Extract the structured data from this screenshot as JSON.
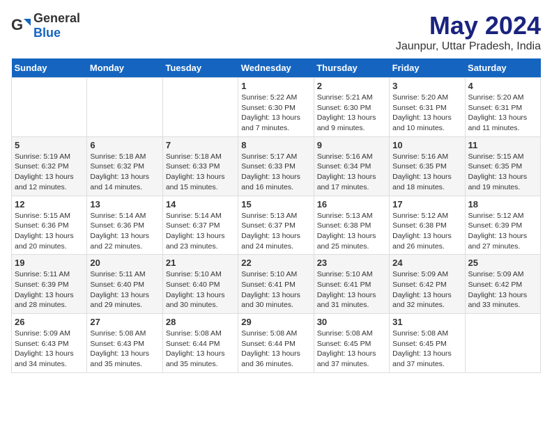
{
  "logo": {
    "general": "General",
    "blue": "Blue"
  },
  "header": {
    "month_year": "May 2024",
    "location": "Jaunpur, Uttar Pradesh, India"
  },
  "days_of_week": [
    "Sunday",
    "Monday",
    "Tuesday",
    "Wednesday",
    "Thursday",
    "Friday",
    "Saturday"
  ],
  "weeks": [
    [
      {
        "day": "",
        "info": ""
      },
      {
        "day": "",
        "info": ""
      },
      {
        "day": "",
        "info": ""
      },
      {
        "day": "1",
        "info": "Sunrise: 5:22 AM\nSunset: 6:30 PM\nDaylight: 13 hours\nand 7 minutes."
      },
      {
        "day": "2",
        "info": "Sunrise: 5:21 AM\nSunset: 6:30 PM\nDaylight: 13 hours\nand 9 minutes."
      },
      {
        "day": "3",
        "info": "Sunrise: 5:20 AM\nSunset: 6:31 PM\nDaylight: 13 hours\nand 10 minutes."
      },
      {
        "day": "4",
        "info": "Sunrise: 5:20 AM\nSunset: 6:31 PM\nDaylight: 13 hours\nand 11 minutes."
      }
    ],
    [
      {
        "day": "5",
        "info": "Sunrise: 5:19 AM\nSunset: 6:32 PM\nDaylight: 13 hours\nand 12 minutes."
      },
      {
        "day": "6",
        "info": "Sunrise: 5:18 AM\nSunset: 6:32 PM\nDaylight: 13 hours\nand 14 minutes."
      },
      {
        "day": "7",
        "info": "Sunrise: 5:18 AM\nSunset: 6:33 PM\nDaylight: 13 hours\nand 15 minutes."
      },
      {
        "day": "8",
        "info": "Sunrise: 5:17 AM\nSunset: 6:33 PM\nDaylight: 13 hours\nand 16 minutes."
      },
      {
        "day": "9",
        "info": "Sunrise: 5:16 AM\nSunset: 6:34 PM\nDaylight: 13 hours\nand 17 minutes."
      },
      {
        "day": "10",
        "info": "Sunrise: 5:16 AM\nSunset: 6:35 PM\nDaylight: 13 hours\nand 18 minutes."
      },
      {
        "day": "11",
        "info": "Sunrise: 5:15 AM\nSunset: 6:35 PM\nDaylight: 13 hours\nand 19 minutes."
      }
    ],
    [
      {
        "day": "12",
        "info": "Sunrise: 5:15 AM\nSunset: 6:36 PM\nDaylight: 13 hours\nand 20 minutes."
      },
      {
        "day": "13",
        "info": "Sunrise: 5:14 AM\nSunset: 6:36 PM\nDaylight: 13 hours\nand 22 minutes."
      },
      {
        "day": "14",
        "info": "Sunrise: 5:14 AM\nSunset: 6:37 PM\nDaylight: 13 hours\nand 23 minutes."
      },
      {
        "day": "15",
        "info": "Sunrise: 5:13 AM\nSunset: 6:37 PM\nDaylight: 13 hours\nand 24 minutes."
      },
      {
        "day": "16",
        "info": "Sunrise: 5:13 AM\nSunset: 6:38 PM\nDaylight: 13 hours\nand 25 minutes."
      },
      {
        "day": "17",
        "info": "Sunrise: 5:12 AM\nSunset: 6:38 PM\nDaylight: 13 hours\nand 26 minutes."
      },
      {
        "day": "18",
        "info": "Sunrise: 5:12 AM\nSunset: 6:39 PM\nDaylight: 13 hours\nand 27 minutes."
      }
    ],
    [
      {
        "day": "19",
        "info": "Sunrise: 5:11 AM\nSunset: 6:39 PM\nDaylight: 13 hours\nand 28 minutes."
      },
      {
        "day": "20",
        "info": "Sunrise: 5:11 AM\nSunset: 6:40 PM\nDaylight: 13 hours\nand 29 minutes."
      },
      {
        "day": "21",
        "info": "Sunrise: 5:10 AM\nSunset: 6:40 PM\nDaylight: 13 hours\nand 30 minutes."
      },
      {
        "day": "22",
        "info": "Sunrise: 5:10 AM\nSunset: 6:41 PM\nDaylight: 13 hours\nand 30 minutes."
      },
      {
        "day": "23",
        "info": "Sunrise: 5:10 AM\nSunset: 6:41 PM\nDaylight: 13 hours\nand 31 minutes."
      },
      {
        "day": "24",
        "info": "Sunrise: 5:09 AM\nSunset: 6:42 PM\nDaylight: 13 hours\nand 32 minutes."
      },
      {
        "day": "25",
        "info": "Sunrise: 5:09 AM\nSunset: 6:42 PM\nDaylight: 13 hours\nand 33 minutes."
      }
    ],
    [
      {
        "day": "26",
        "info": "Sunrise: 5:09 AM\nSunset: 6:43 PM\nDaylight: 13 hours\nand 34 minutes."
      },
      {
        "day": "27",
        "info": "Sunrise: 5:08 AM\nSunset: 6:43 PM\nDaylight: 13 hours\nand 35 minutes."
      },
      {
        "day": "28",
        "info": "Sunrise: 5:08 AM\nSunset: 6:44 PM\nDaylight: 13 hours\nand 35 minutes."
      },
      {
        "day": "29",
        "info": "Sunrise: 5:08 AM\nSunset: 6:44 PM\nDaylight: 13 hours\nand 36 minutes."
      },
      {
        "day": "30",
        "info": "Sunrise: 5:08 AM\nSunset: 6:45 PM\nDaylight: 13 hours\nand 37 minutes."
      },
      {
        "day": "31",
        "info": "Sunrise: 5:08 AM\nSunset: 6:45 PM\nDaylight: 13 hours\nand 37 minutes."
      },
      {
        "day": "",
        "info": ""
      }
    ]
  ]
}
